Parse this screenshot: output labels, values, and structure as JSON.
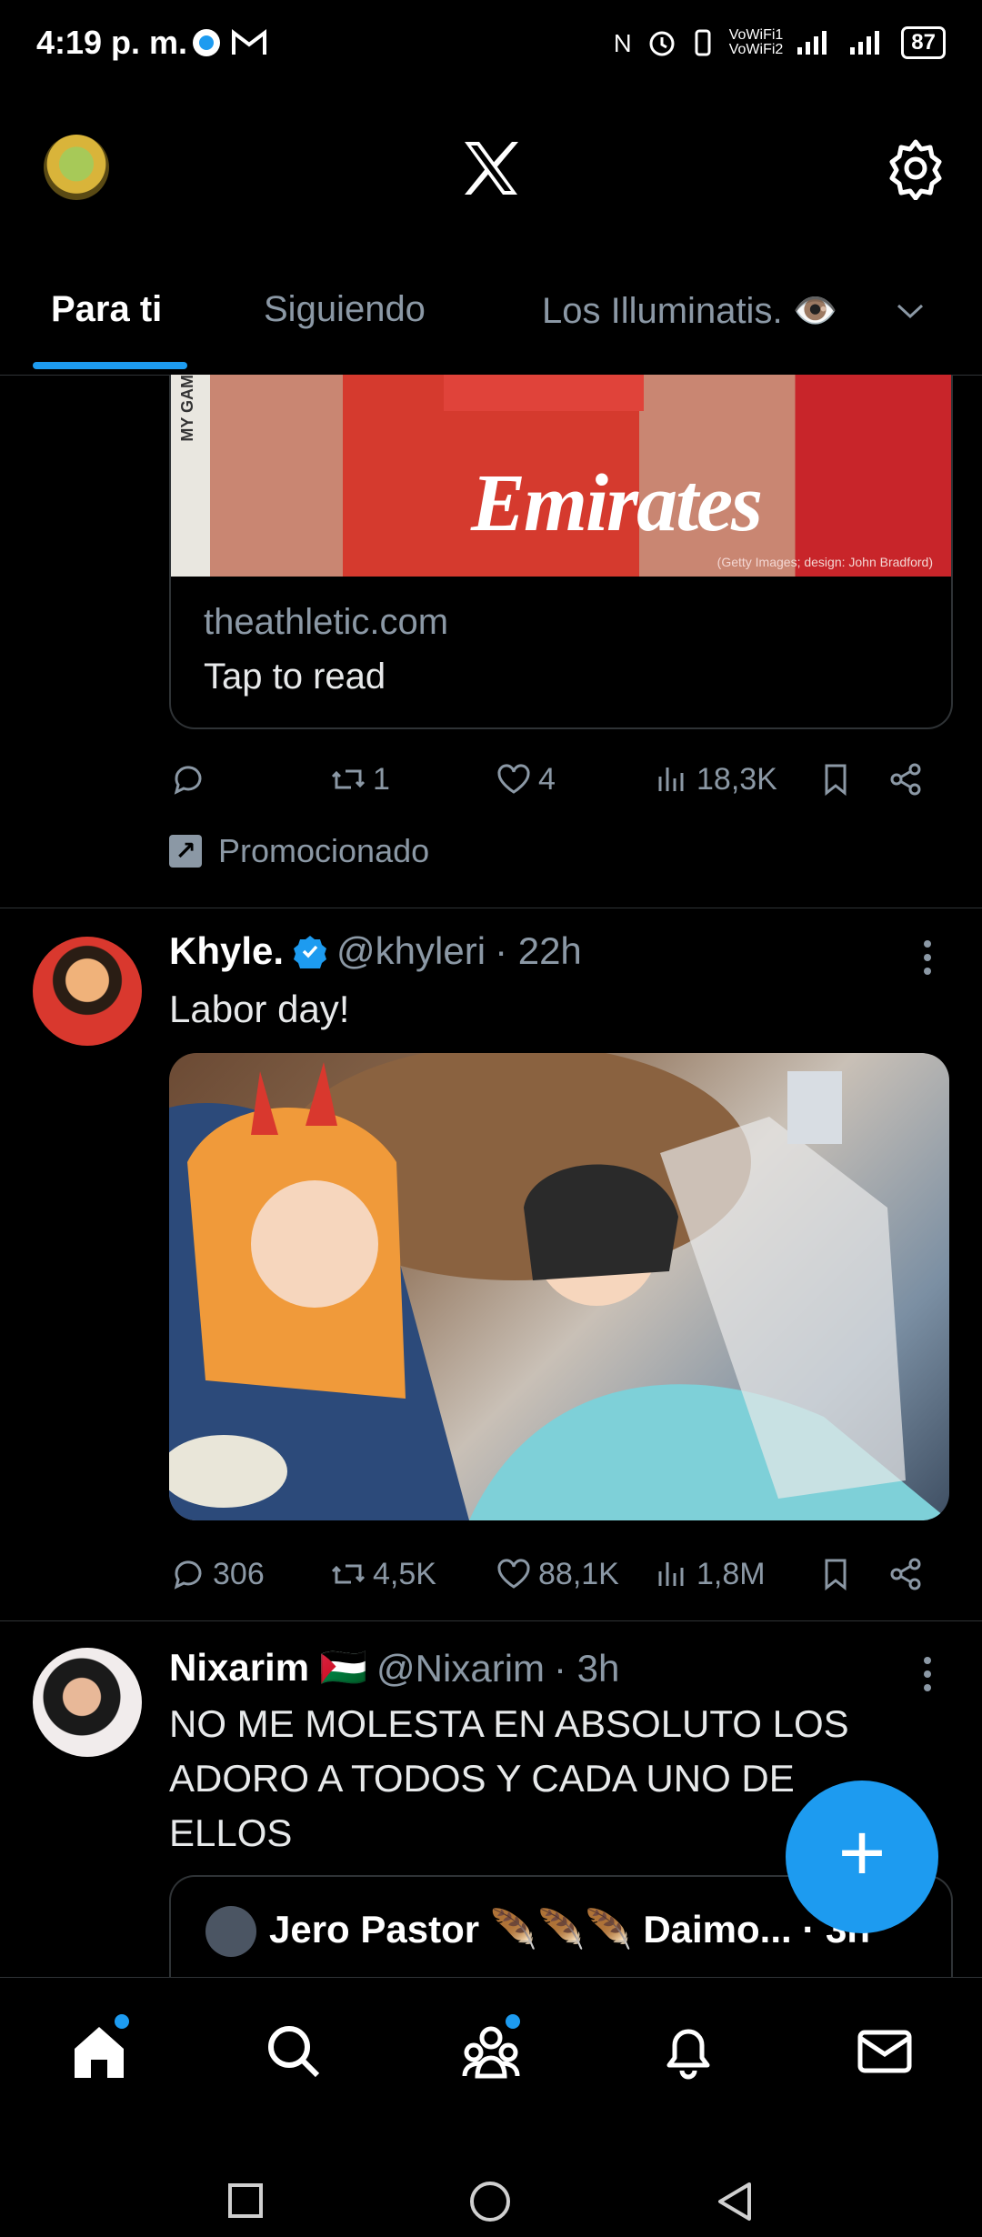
{
  "status_bar": {
    "time": "4:19 p. m.",
    "wifi_label_1": "VoWiFi1",
    "wifi_label_2": "VoWiFi2",
    "battery": "87"
  },
  "tabs": [
    {
      "label": "Para ti",
      "active": true
    },
    {
      "label": "Siguiendo",
      "active": false
    },
    {
      "label": "Los Illuminatis. 👁️",
      "active": false
    }
  ],
  "promo_tweet": {
    "card_domain": "theathletic.com",
    "card_cta": "Tap to read",
    "card_image_watermark": "Emirates",
    "actions": {
      "replies": "",
      "reposts": "1",
      "likes": "4",
      "views": "18,3K"
    },
    "promoted_label": "Promocionado"
  },
  "tweet1": {
    "name": "Khyle.",
    "verified": true,
    "handle": "@khyleri",
    "time": "· 22h",
    "text": "Labor day!",
    "actions": {
      "replies": "306",
      "reposts": "4,5K",
      "likes": "88,1K",
      "views": "1,8M"
    }
  },
  "tweet2": {
    "name": "Nixarim 🇵🇸",
    "handle": "@Nixarim",
    "time": "· 3h",
    "text": "NO ME MOLESTA EN ABSOLUTO LOS ADORO A TODOS Y CADA UNO DE ELLOS",
    "quote_text": "Jero Pastor 🪶🪶🪶 Daimo... · 3h"
  },
  "colors": {
    "accent": "#1d9bf0",
    "bg": "#000000",
    "muted": "#8b98a5",
    "text": "#e7e9ea",
    "border": "#2f3336"
  },
  "icons": [
    "x-logo-icon",
    "gear-icon",
    "reply-icon",
    "repost-icon",
    "like-icon",
    "views-icon",
    "bookmark-icon",
    "share-icon",
    "more-icon",
    "home-icon",
    "search-icon",
    "communities-icon",
    "bell-icon",
    "mail-icon",
    "plus-icon"
  ]
}
